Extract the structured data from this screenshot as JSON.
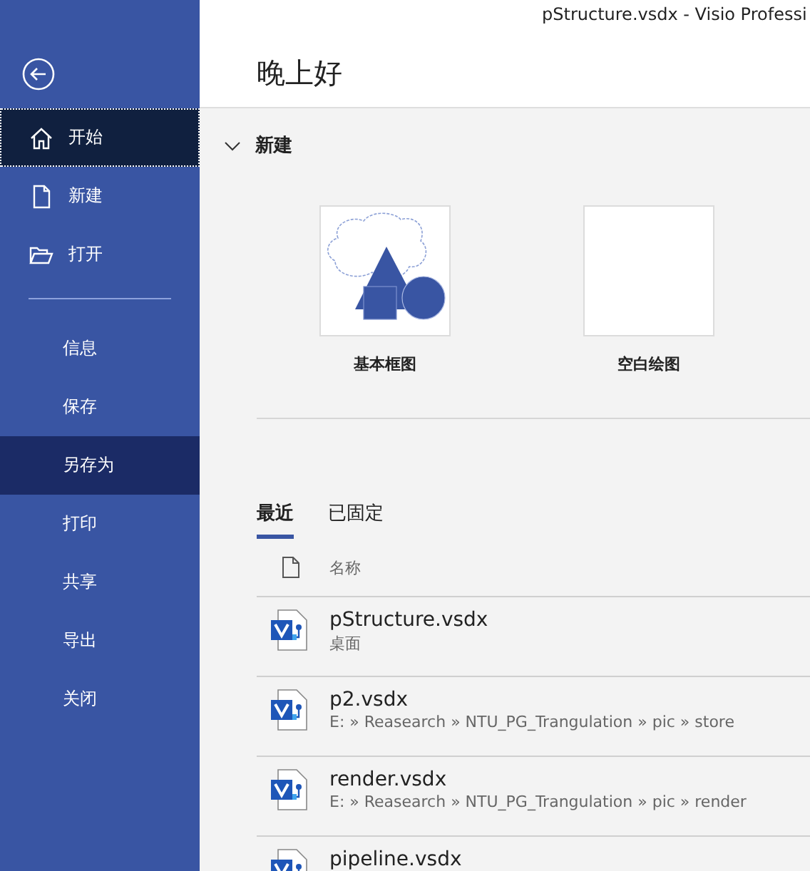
{
  "window": {
    "title": "pStructure.vsdx  -  Visio Professi"
  },
  "sidebar": {
    "items": [
      {
        "label": "开始",
        "kind": "home",
        "selected": true,
        "hovered": false
      },
      {
        "label": "新建",
        "kind": "new",
        "selected": false,
        "hovered": false
      },
      {
        "label": "打开",
        "kind": "open",
        "selected": false,
        "hovered": false
      },
      {
        "kind": "divider"
      },
      {
        "label": "信息",
        "kind": "plain",
        "selected": false,
        "hovered": false
      },
      {
        "label": "保存",
        "kind": "plain",
        "selected": false,
        "hovered": false
      },
      {
        "label": "另存为",
        "kind": "plain",
        "selected": false,
        "hovered": true
      },
      {
        "label": "打印",
        "kind": "plain",
        "selected": false,
        "hovered": false
      },
      {
        "label": "共享",
        "kind": "plain",
        "selected": false,
        "hovered": false
      },
      {
        "label": "导出",
        "kind": "plain",
        "selected": false,
        "hovered": false
      },
      {
        "label": "关闭",
        "kind": "plain",
        "selected": false,
        "hovered": false
      }
    ]
  },
  "greeting": "晚上好",
  "new_section": {
    "title": "新建",
    "expanded": true,
    "templates": [
      {
        "label": "基本框图",
        "kind": "basic"
      },
      {
        "label": "空白绘图",
        "kind": "blank"
      }
    ]
  },
  "file_tabs": [
    {
      "label": "最近",
      "selected": true
    },
    {
      "label": "已固定",
      "selected": false
    }
  ],
  "file_list": {
    "column": "名称",
    "rows": [
      {
        "name": "pStructure.vsdx",
        "location": "桌面"
      },
      {
        "name": "p2.vsdx",
        "location": "E: » Reasearch » NTU_PG_Trangulation » pic » store"
      },
      {
        "name": "render.vsdx",
        "location": "E: » Reasearch » NTU_PG_Trangulation » pic » render"
      },
      {
        "name": "pipeline.vsdx"
      }
    ]
  }
}
